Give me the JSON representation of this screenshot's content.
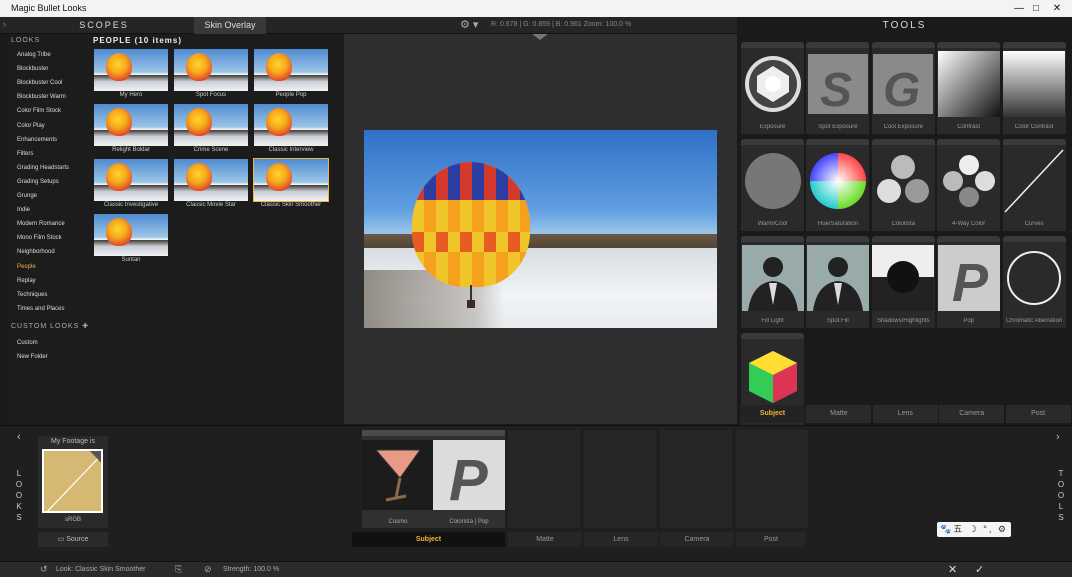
{
  "window": {
    "title": "Magic Bullet Looks",
    "controls": [
      "—",
      "□",
      "✕"
    ]
  },
  "header": {
    "expand_icon": "›",
    "scopes_tab": "SCOPES",
    "skin_overlay_tab": "Skin Overlay",
    "gear_icon": "⚙ ▾",
    "readout": "R: 0.678  |  G: 0.859  |  B: 0.961     Zoom: 100.0 %"
  },
  "looks_sidebar": {
    "heading": "LOOKS",
    "categories": [
      "Analog Tribe",
      "Blockbuster",
      "Blockbuster Cool",
      "Blockbuster Warm",
      "Color Film Stock",
      "Color Play",
      "Enhancements",
      "Filters",
      "Grading Headstarts",
      "Grading Setups",
      "Grunge",
      "Indie",
      "Modern Romance",
      "Mono Film Stock",
      "Neighborhood",
      "People",
      "Replay",
      "Techniques",
      "Times and Places"
    ],
    "active_category": "People",
    "custom_heading": "CUSTOM LOOKS ✚",
    "custom_items": [
      "Custom",
      "New Folder"
    ]
  },
  "grid": {
    "title": "PEOPLE (10 items)",
    "items": [
      "My Hero",
      "Spot Focus",
      "People Pop",
      "Relight Boldar",
      "Crime Scene",
      "Classic Interview",
      "Classic Investigative",
      "Classic Movie Star",
      "Classic Skin Smoother",
      "Suntan"
    ],
    "selected": "Classic Skin Smoother"
  },
  "tools": {
    "title": "TOOLS",
    "items": [
      "Exposure",
      "Spot Exposure",
      "Cool Exposure",
      "Contrast",
      "Color Contrast",
      "Warm/Cool",
      "Hue/Saturation",
      "Colorista",
      "4-Way Color",
      "Curves",
      "Fill Light",
      "Spot Fill",
      "Shadows/Highlights",
      "Pop",
      "Chromatic Aberration",
      ""
    ],
    "tabs": [
      "Subject",
      "Matte",
      "Lens",
      "Camera",
      "Post"
    ],
    "active_tab": "Subject"
  },
  "bottom": {
    "looks_vertical": "LOOKS",
    "tools_vertical": "TOOLS",
    "source_title": "My Footage is",
    "source_colorspace": "sRGB",
    "source_button": "Source",
    "chain": [
      "Cosmo",
      "Colorista | Pop"
    ],
    "chain_tabs": [
      "Subject",
      "Matte",
      "Lens",
      "Camera",
      "Post"
    ],
    "active_chain_tab": "Subject"
  },
  "status": {
    "look": "Look: Classic Skin Smoother",
    "strength": "Strength: 100.0 %",
    "cancel_icon": "✕",
    "ok_icon": "✓"
  },
  "ime_toolbar": "🐾五 ☽ °, ⚙",
  "colors": {
    "accent": "#f1b33a",
    "panel_bg": "#1a1a1a",
    "viewer_bg": "#2e2e2e"
  }
}
